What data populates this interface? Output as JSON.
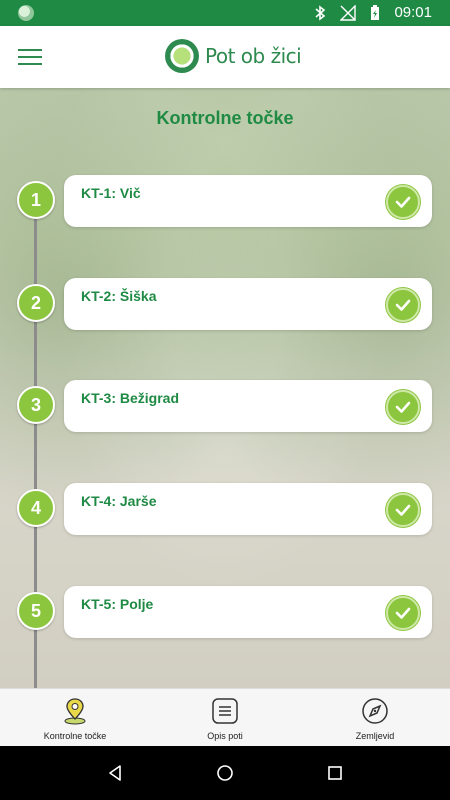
{
  "status_bar": {
    "time": "09:01"
  },
  "app": {
    "logo_text": "Pot ob žici"
  },
  "page": {
    "title": "Kontrolne točke"
  },
  "checkpoints": [
    {
      "number": "1",
      "label": "KT-1: Vič",
      "completed": true
    },
    {
      "number": "2",
      "label": "KT-2: Šiška",
      "completed": true
    },
    {
      "number": "3",
      "label": "KT-3: Bežigrad",
      "completed": true
    },
    {
      "number": "4",
      "label": "KT-4: Jarše",
      "completed": true
    },
    {
      "number": "5",
      "label": "KT-5: Polje",
      "completed": true
    }
  ],
  "bottom_nav": [
    {
      "label": "Kontrolne točke",
      "icon": "map-pin-icon",
      "active": true
    },
    {
      "label": "Opis poti",
      "icon": "list-icon"
    },
    {
      "label": "Zemljevid",
      "icon": "compass-icon"
    }
  ],
  "colors": {
    "primary_green": "#1f8a44",
    "accent_green": "#8cc63f",
    "status_bar": "#1e8a44"
  }
}
